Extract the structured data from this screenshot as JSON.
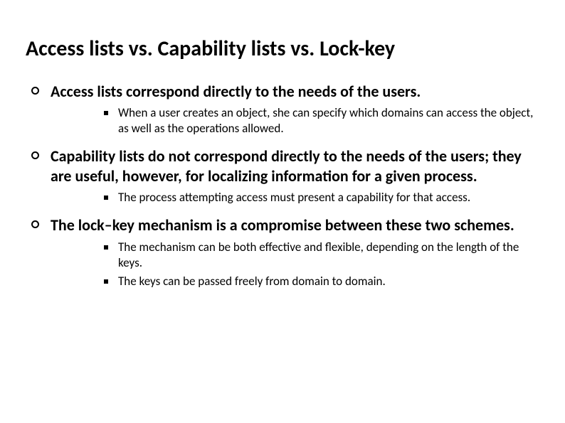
{
  "title": "Access lists vs. Capability lists vs. Lock-key",
  "items": [
    {
      "text": "Access lists correspond directly to the needs of the users.",
      "subs": [
        "When a user creates an object, she can specify which domains can access the object, as well as the operations allowed."
      ]
    },
    {
      "text": "Capability lists do not correspond directly to the needs of the users; they are useful, however, for localizing information for a given process.",
      "subs": [
        "The process attempting access must present a capability for that access."
      ]
    },
    {
      "text": "The lock–key mechanism is a compromise between these two schemes.",
      "subs": [
        "The mechanism can be both effective and flexible, depending on the length of the keys.",
        "The keys can be passed freely from domain to domain."
      ]
    }
  ]
}
